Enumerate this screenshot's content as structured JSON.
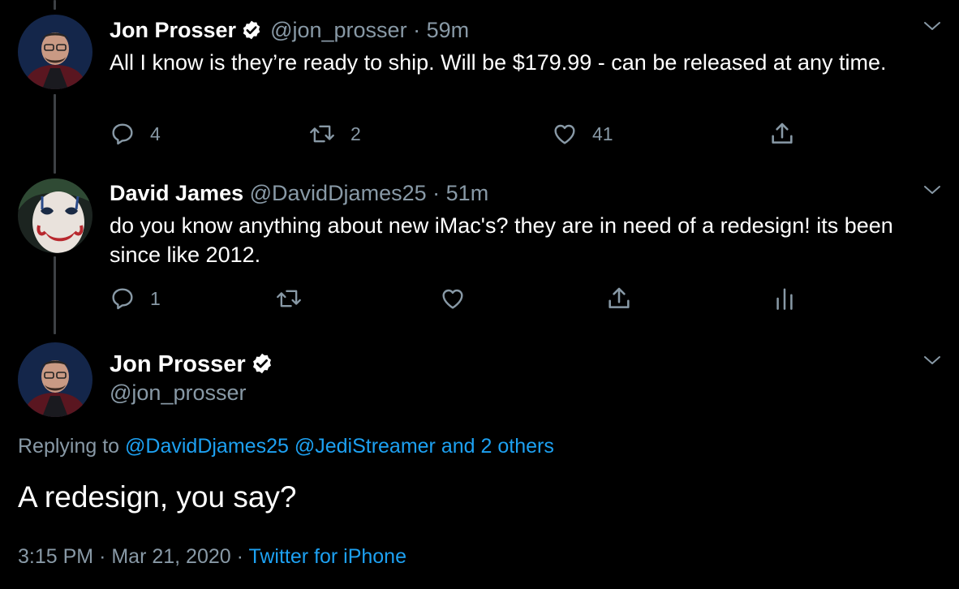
{
  "colors": {
    "background": "#000000",
    "text": "#ffffff",
    "secondary": "#8899a6",
    "accent": "#1da1f2",
    "thread_line": "#3d4145"
  },
  "tweets": [
    {
      "name": "Jon Prosser",
      "verified": true,
      "handle": "@jon_prosser",
      "separator": "·",
      "time": "59m",
      "text": "All I know is they’re ready to ship. Will be $179.99 - can be released at any time.",
      "replies": "4",
      "retweets": "2",
      "likes": "41"
    },
    {
      "name": "David James",
      "verified": false,
      "handle": "@DavidDjames25",
      "separator": "·",
      "time": "51m",
      "text": "do you know anything about new iMac's? they are in need of a redesign! its been since like 2012.",
      "replies": "1"
    }
  ],
  "focus_tweet": {
    "name": "Jon Prosser",
    "verified": true,
    "handle": "@jon_prosser",
    "replying_prefix": "Replying to",
    "mention_1": "@DavidDjames25",
    "mention_2": "@JediStreamer",
    "mention_others": "and 2 others",
    "text": "A redesign, you say?",
    "time": "3:15 PM",
    "separator_1": "·",
    "date": "Mar 21, 2020",
    "separator_2": "·",
    "source": "Twitter for iPhone"
  },
  "icons": {
    "reply": "reply-icon",
    "retweet": "retweet-icon",
    "like": "heart-icon",
    "share": "share-icon",
    "analytics": "analytics-icon",
    "more": "chevron-down-icon",
    "verified": "verified-badge-icon"
  }
}
